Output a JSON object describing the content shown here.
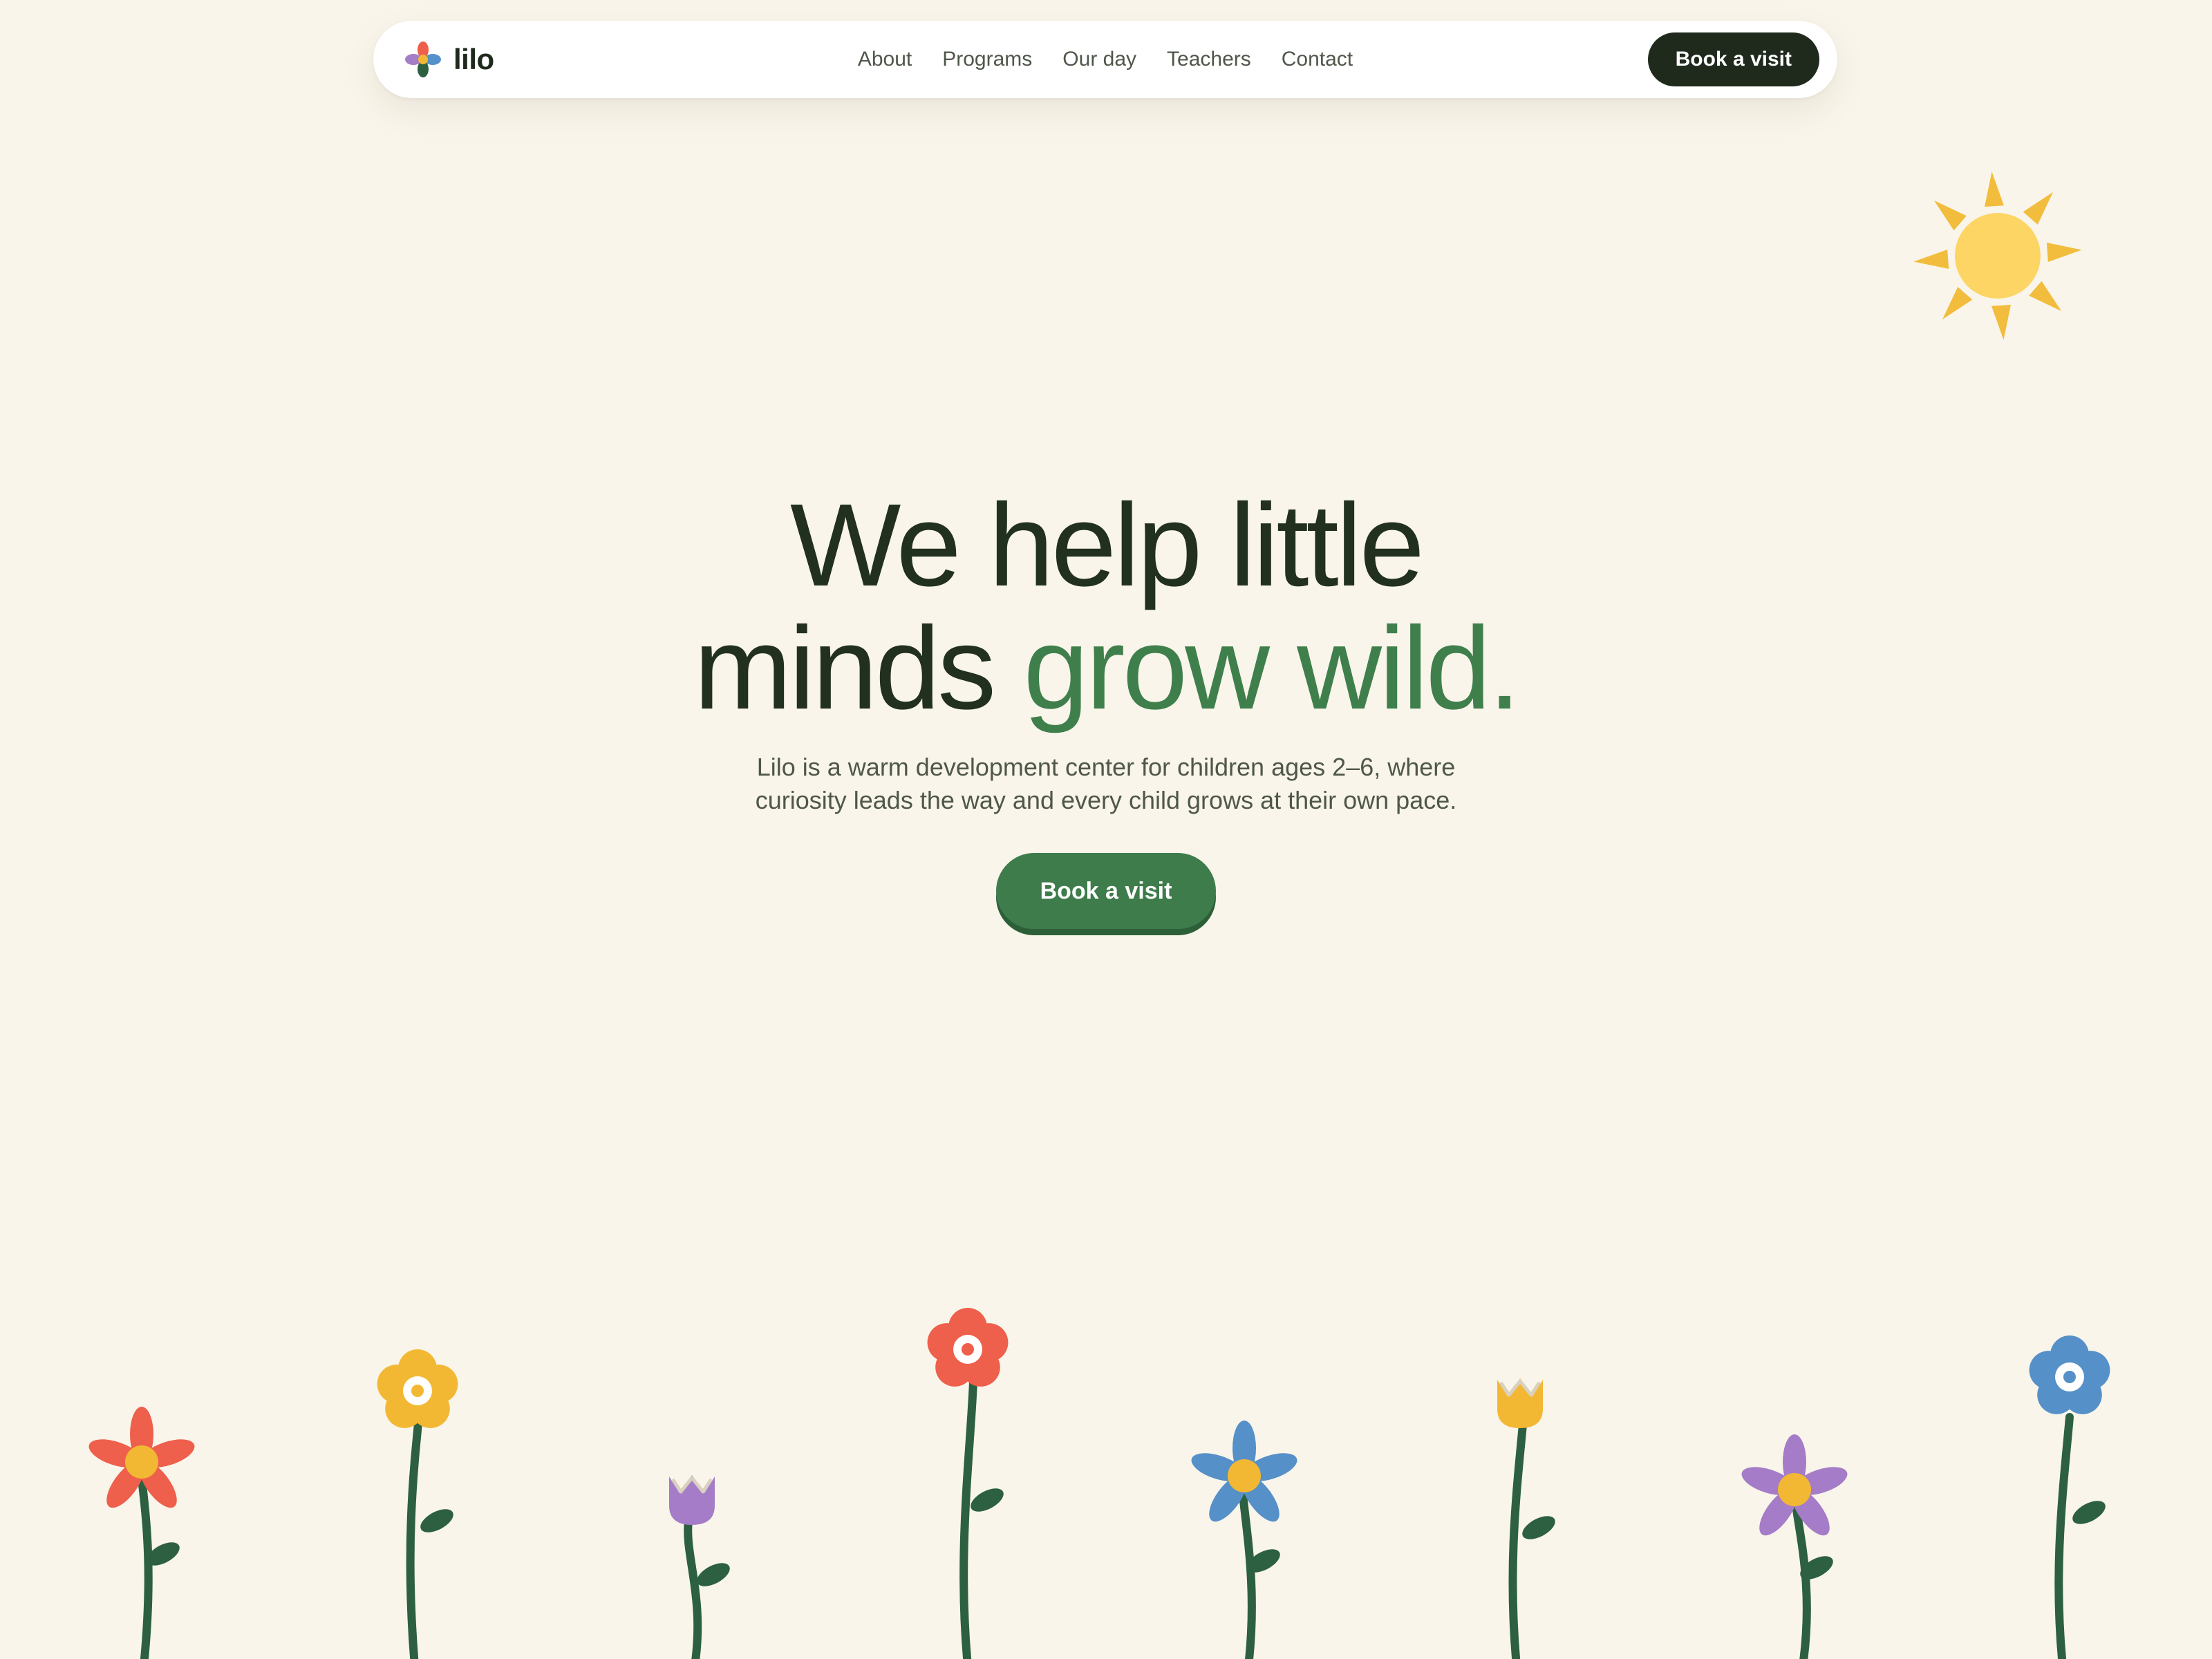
{
  "brand": {
    "name": "lilo"
  },
  "nav": {
    "links": [
      "About",
      "Programs",
      "Our day",
      "Teachers",
      "Contact"
    ],
    "cta_label": "Book a visit"
  },
  "hero": {
    "title_line1": "We help little",
    "title_line2_plain": "minds ",
    "title_line2_accent": "grow wild.",
    "subtitle": "Lilo is a warm development center for children ages 2–6, where curiosity leads the way and every child grows at their own pace.",
    "cta_label": "Book a visit"
  },
  "colors": {
    "background": "#f9f5ea",
    "ink": "#22301f",
    "accent_green": "#3e7c4b",
    "nav_button": "#1f2a1c",
    "sun": "#fdd565",
    "sun_rays": "#f2bd3c",
    "stem": "#2c6040",
    "flower_red": "#ee5f4c",
    "flower_yellow": "#f3b833",
    "flower_purple": "#a57cc7",
    "flower_blue": "#5690c8"
  },
  "decorations": {
    "logo_icon": "four-petal-flower-icon",
    "sun_icon": "sun-icon",
    "flowers": [
      "red-daisy",
      "yellow-blossom",
      "purple-tulip",
      "red-blossom",
      "blue-daisy",
      "yellow-tulip",
      "purple-daisy",
      "blue-blossom"
    ]
  }
}
